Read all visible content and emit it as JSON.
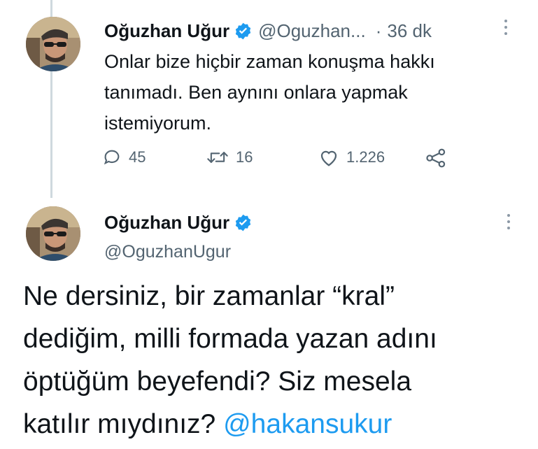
{
  "tweet1": {
    "author_name": "Oğuzhan Uğur",
    "author_handle": "@Oguzhan...",
    "separator": "·",
    "timestamp": "36 dk",
    "text_lines": [
      "Onlar bize hiçbir zaman konuşma hakkı",
      "tanımadı. Ben aynını onlara yapmak",
      "istemiyorum."
    ],
    "replies": "45",
    "retweets": "16",
    "likes": "1.226"
  },
  "tweet2": {
    "author_name": "Oğuzhan Uğur",
    "author_handle": "@OguzhanUgur",
    "text_lines": [
      "Ne dersiniz, bir zamanlar “kral”",
      "dediğim, milli formada yazan adını",
      "öptüğüm beyefendi? Siz mesela"
    ],
    "last_line_text": "katılır mıydınız? ",
    "mention": "@hakansukur"
  },
  "colors": {
    "verified": "#1d9bf0",
    "mention": "#1d9bf0",
    "secondary_text": "#536471",
    "thread_line": "#cfd9de"
  }
}
